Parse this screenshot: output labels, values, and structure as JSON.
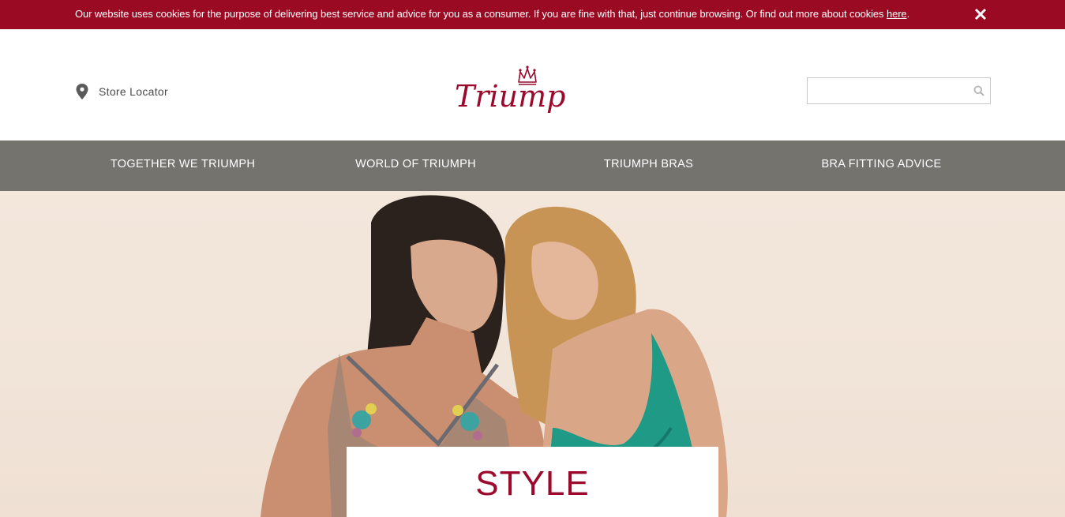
{
  "cookie_banner": {
    "text": "Our website uses cookies for the purpose of delivering best service and advice for you as a consumer. If you are fine with that, just continue browsing. Or find out more about cookies ",
    "link_text": "here",
    "suffix": ".",
    "close_icon": "close-icon",
    "background": "#9b0a23"
  },
  "header": {
    "store_locator_label": "Store Locator",
    "store_locator_icon": "map-pin-icon",
    "logo_text": "Triumph",
    "search": {
      "placeholder": "",
      "value": "",
      "icon": "search-icon"
    }
  },
  "nav": {
    "background": "#74736e",
    "items": [
      {
        "label": "TOGETHER WE TRIUMPH"
      },
      {
        "label": "WORLD OF TRIUMPH"
      },
      {
        "label": "TRIUMPH BRAS"
      },
      {
        "label": "BRA FITTING ADVICE"
      }
    ]
  },
  "hero": {
    "title": "STYLE",
    "accent": "#9b0a2c"
  }
}
